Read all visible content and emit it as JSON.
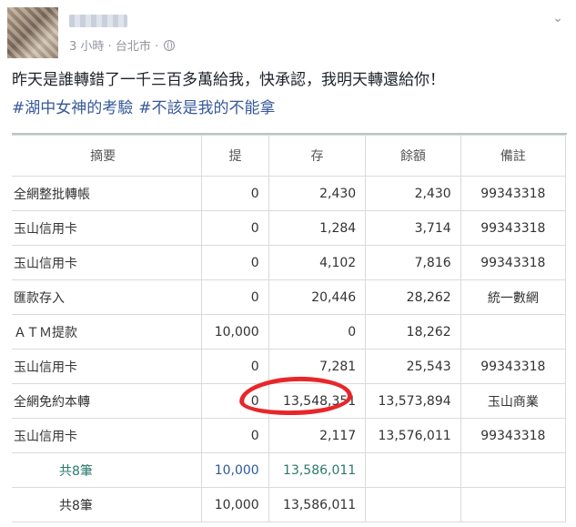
{
  "post": {
    "time": "3 小時",
    "location": "台北市",
    "separator1": "·",
    "separator2": "·",
    "text": "昨天是誰轉錯了一千三百多萬給我，快承認，我明天轉還給你！",
    "hashtags": [
      "#湖中女神的考驗",
      "#不該是我的不能拿"
    ],
    "options_icon": "chevron-down-icon",
    "privacy_icon": "globe-icon"
  },
  "ledger": {
    "headers": [
      "摘要",
      "提",
      "存",
      "餘額",
      "備註"
    ],
    "rows": [
      [
        "全網整批轉帳",
        "0",
        "2,430",
        "2,430",
        "99343318"
      ],
      [
        "玉山信用卡",
        "0",
        "1,284",
        "3,714",
        "99343318"
      ],
      [
        "玉山信用卡",
        "0",
        "4,102",
        "7,816",
        "99343318"
      ],
      [
        "匯款存入",
        "0",
        "20,446",
        "28,262",
        "統一數網"
      ],
      [
        "ＡＴＭ提款",
        "10,000",
        "0",
        "18,262",
        ""
      ],
      [
        "玉山信用卡",
        "0",
        "7,281",
        "25,543",
        "99343318"
      ],
      [
        "全網免約本轉",
        "0",
        "13,548,351",
        "13,573,894",
        "玉山商業"
      ],
      [
        "玉山信用卡",
        "0",
        "2,117",
        "13,576,011",
        "99343318"
      ]
    ],
    "totals": [
      [
        "共8筆",
        "10,000",
        "13,586,011",
        "",
        ""
      ],
      [
        "共8筆",
        "10,000",
        "13,586,011",
        "",
        ""
      ]
    ],
    "highlight_color": "#e8262a"
  }
}
